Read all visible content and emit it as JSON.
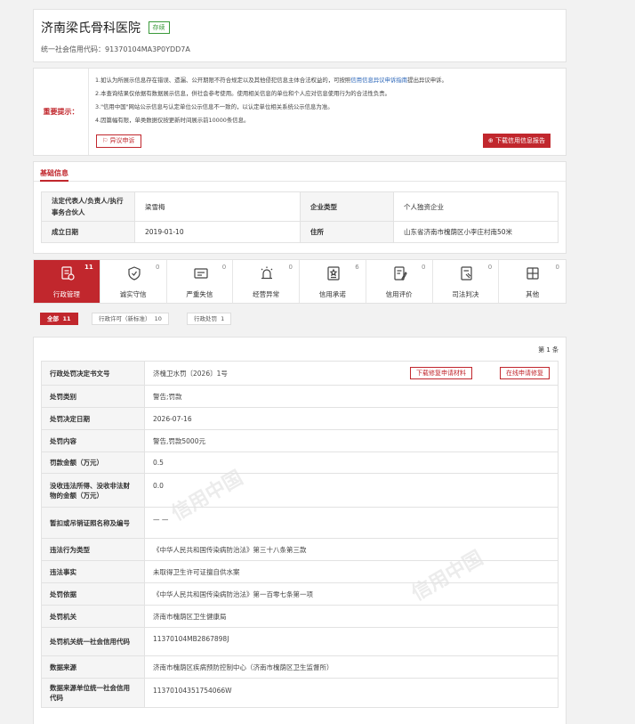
{
  "header": {
    "title": "济南梁氏骨科医院",
    "status": "存续",
    "credit_code_label": "统一社会信用代码：",
    "credit_code": "91370104MA3P0YDD7A"
  },
  "notice": {
    "label": "重要提示：",
    "line1_pre": "1.如认为所展示信息存在错误、遗漏、公开期限不符合规定以及其他侵犯信息主体合法权益的，可按照",
    "line1_link": "信用信息异议申诉指南",
    "line1_post": "提出异议申诉。",
    "line2": "2.本查询结果仅依据有数据展示信息，供社会参考使用。使用相关信息的单位和个人应对信息使用行为的合法性负责。",
    "line3": "3.\"信用中国\"网站公示信息与认定单位公示信息不一致的，以认定单位相关系统公示信息为准。",
    "line4": "4.因篇幅有限，单类数据仅按更新时间展示前10000条信息。",
    "appeal_button": "异议申诉",
    "download_button": "下载信用信息报告"
  },
  "basic": {
    "title": "基础信息",
    "rows": [
      {
        "k1": "法定代表人/负责人/执行事务合伙人",
        "v1": "梁雪梅",
        "k2": "企业类型",
        "v2": "个人独资企业"
      },
      {
        "k1": "成立日期",
        "v1": "2019-01-10",
        "k2": "住所",
        "v2": "山东省济南市槐荫区小李庄村南50米"
      }
    ]
  },
  "tabs": [
    {
      "label": "行政管理",
      "count": "11",
      "icon": "admin-doc-icon"
    },
    {
      "label": "诚实守信",
      "count": "0",
      "icon": "shield-icon"
    },
    {
      "label": "严重失信",
      "count": "0",
      "icon": "warning-card-icon"
    },
    {
      "label": "经营异常",
      "count": "0",
      "icon": "alarm-light-icon"
    },
    {
      "label": "信用承诺",
      "count": "6",
      "icon": "commitment-icon"
    },
    {
      "label": "信用评价",
      "count": "0",
      "icon": "evaluation-icon"
    },
    {
      "label": "司法判决",
      "count": "0",
      "icon": "judgment-icon"
    },
    {
      "label": "其他",
      "count": "0",
      "icon": "other-icon"
    }
  ],
  "filters": [
    {
      "label": "全部",
      "count": "11"
    },
    {
      "label": "行政许可（新标准）",
      "count": "10"
    },
    {
      "label": "行政处罚",
      "count": "1"
    }
  ],
  "detail": {
    "page_indicator": "第 1 条",
    "repair_download": "下载修复申请材料",
    "repair_online": "在线申请修复",
    "watermark": "信用中国",
    "rows": [
      {
        "k": "行政处罚决定书文号",
        "v": "济槐卫水罚〔2026〕1号"
      },
      {
        "k": "处罚类别",
        "v": "警告;罚款"
      },
      {
        "k": "处罚决定日期",
        "v": "2026-07-16"
      },
      {
        "k": "处罚内容",
        "v": "警告,罚款5000元"
      },
      {
        "k": "罚款金额（万元）",
        "v": "0.5"
      },
      {
        "k": "没收违法所得、没收非法财物的金额（万元）",
        "v": "0.0"
      },
      {
        "k": "暂扣或吊销证照名称及编号",
        "v": "— —"
      },
      {
        "k": "违法行为类型",
        "v": "《中华人民共和国传染病防治法》第三十八条第三款"
      },
      {
        "k": "违法事实",
        "v": "未取得卫生许可证擅自供水案"
      },
      {
        "k": "处罚依据",
        "v": "《中华人民共和国传染病防治法》第一百零七条第一项"
      },
      {
        "k": "处罚机关",
        "v": "济南市槐荫区卫生健康局"
      },
      {
        "k": "处罚机关统一社会信用代码",
        "v": "11370104MB2867898J"
      },
      {
        "k": "数据来源",
        "v": "济南市槐荫区疾病预防控制中心（济南市槐荫区卫生监督所）"
      },
      {
        "k": "数据来源单位统一社会信用代码",
        "v": "11370104351754066W"
      }
    ]
  }
}
